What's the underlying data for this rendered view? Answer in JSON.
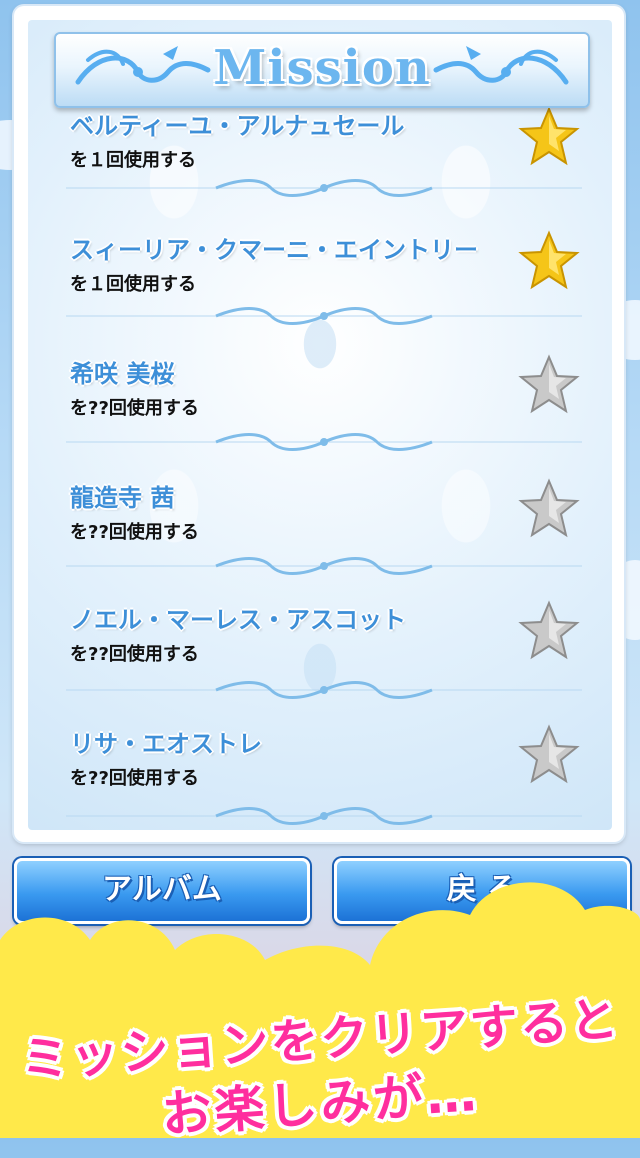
{
  "header": {
    "title": "Mission"
  },
  "missions": [
    {
      "name": "ベルティーユ・アルナュセール",
      "desc": "を１回使用する",
      "star": "gold"
    },
    {
      "name": "スィーリア・クマーニ・エイントリー",
      "desc": "を１回使用する",
      "star": "gold"
    },
    {
      "name": "希咲 美桜",
      "desc": "を??回使用する",
      "star": "silver"
    },
    {
      "name": "龍造寺 茜",
      "desc": "を??回使用する",
      "star": "silver"
    },
    {
      "name": "ノエル・マーレス・アスコット",
      "desc": "を??回使用する",
      "star": "silver"
    },
    {
      "name": "リサ・エオストレ",
      "desc": "を??回使用する",
      "star": "silver"
    }
  ],
  "buttons": {
    "album": "アルバム",
    "back": "戻 る"
  },
  "promo": {
    "line1": "ミッションをクリアすると",
    "line2": "お楽しみが…"
  },
  "colors": {
    "gold_star": "#f5c518",
    "silver_star": "#c9c9c9",
    "name_blue": "#3d8fd8",
    "promo_pink": "#ff2e9e",
    "promo_yellow": "#ffe94a"
  }
}
